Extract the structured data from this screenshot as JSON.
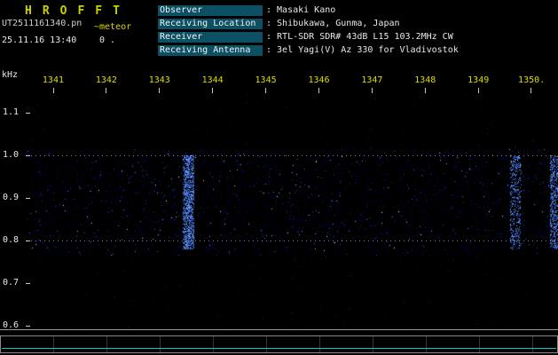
{
  "header": {
    "app_title": "HROFFT",
    "filename": "UT2511161340.pn",
    "file_tag": "~meteor",
    "datetime": "25.11.16 13:40",
    "counter": "0 .",
    "info_rows": [
      {
        "label": "Observer",
        "value": ": Masaki Kano"
      },
      {
        "label": "Receiving Location",
        "value": ": Shibukawa, Gunma, Japan"
      },
      {
        "label": "Receiver",
        "value": ": RTL-SDR SDR# 43dB L15 103.2MHz CW"
      },
      {
        "label": "Receiving Antenna",
        "value": ": 3el Yagi(V) Az 330 for Vladivostok"
      }
    ]
  },
  "axes": {
    "y_unit": "kHz",
    "y_ticks": [
      "1.1",
      "1.0",
      "0.9",
      "0.8",
      "0.7",
      "0.6"
    ],
    "x_ticks": [
      "1341",
      "1342",
      "1343",
      "1344",
      "1345",
      "1346",
      "1347",
      "1348",
      "1349",
      "1350."
    ]
  },
  "colors": {
    "background": "#000000",
    "title_yellow": "#c9d200",
    "x_label_yellow": "#e0dc00",
    "text_white": "#e8e8e8",
    "info_label_box": "#0d4f63",
    "noise_blue": "#2233cc",
    "level_line_cyan": "#00cfcf",
    "frame_gray": "#8a8a8a"
  },
  "chart_data": {
    "type": "heatmap",
    "title": "HROFFT 10-minute radio meteor echo spectrogram",
    "date": "25.11.16",
    "start_time": "13:40",
    "x_minutes_span": 10,
    "x_tick_labels": [
      "1341",
      "1342",
      "1343",
      "1344",
      "1345",
      "1346",
      "1347",
      "1348",
      "1349",
      "1350."
    ],
    "ylabel": "kHz",
    "y_tick_labels": [
      "1.1",
      "1.0",
      "0.9",
      "0.8",
      "0.7",
      "0.6"
    ],
    "ylim_khz": [
      0.58,
      1.15
    ],
    "grid_khz": [
      1.0,
      0.8
    ],
    "noise_band_khz": [
      0.78,
      1.0
    ],
    "noise_description": "continuous dark-blue background noise band between about 0.78 and 1.0 kHz for the whole 10 minutes; no strong meteor echoes",
    "enhanced_noise_columns": [
      {
        "minute": 3.05,
        "strength": 1.0
      },
      {
        "minute": 9.2,
        "strength": 0.4
      },
      {
        "minute": 9.95,
        "strength": 0.6
      }
    ],
    "meteor_echo_events": [],
    "level_strip": {
      "shape": "flat",
      "description": "signal level trace flat near baseline",
      "color": "#00cfcf"
    }
  }
}
